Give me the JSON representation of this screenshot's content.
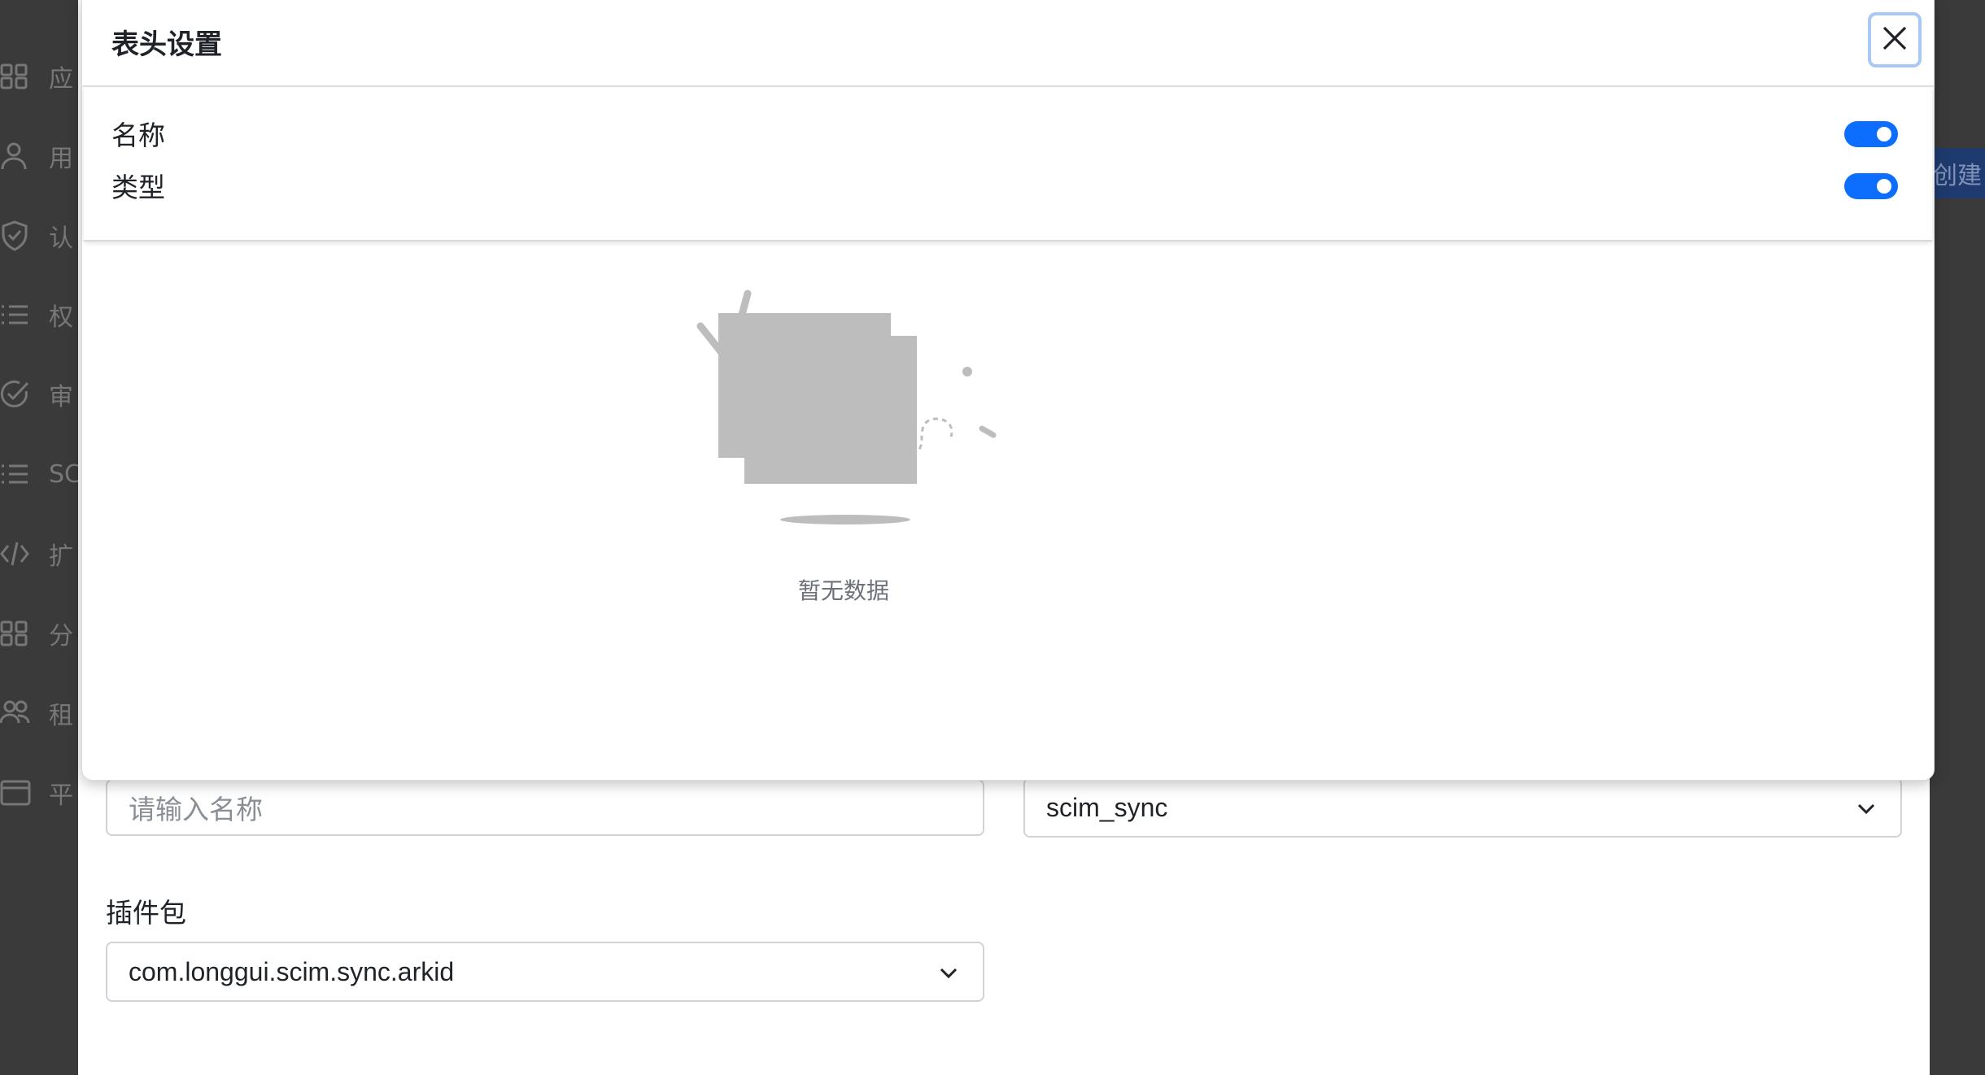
{
  "sidebar": {
    "items": [
      {
        "icon": "grid-icon",
        "label": "应"
      },
      {
        "icon": "user-icon",
        "label": "用"
      },
      {
        "icon": "shield-icon",
        "label": "认"
      },
      {
        "icon": "list-icon",
        "label": "权"
      },
      {
        "icon": "check-circle-icon",
        "label": "审"
      },
      {
        "icon": "list-icon",
        "label": "SC"
      },
      {
        "icon": "code-icon",
        "label": "扩"
      },
      {
        "icon": "grid-icon",
        "label": "分"
      },
      {
        "icon": "users-icon",
        "label": "租"
      },
      {
        "icon": "window-icon",
        "label": "平"
      }
    ]
  },
  "background": {
    "create_button": "创建"
  },
  "panel": {
    "title": "表头设置",
    "columns": [
      {
        "label": "名称",
        "enabled": true
      },
      {
        "label": "类型",
        "enabled": true
      }
    ],
    "empty_text": "暂无数据"
  },
  "form": {
    "name_placeholder": "请输入名称",
    "type_value": "scim_sync",
    "plugin_label": "插件包",
    "plugin_value": "com.longgui.scim.sync.arkid"
  },
  "colors": {
    "accent": "#0d6efd",
    "overlay": "#3a3a3a"
  }
}
